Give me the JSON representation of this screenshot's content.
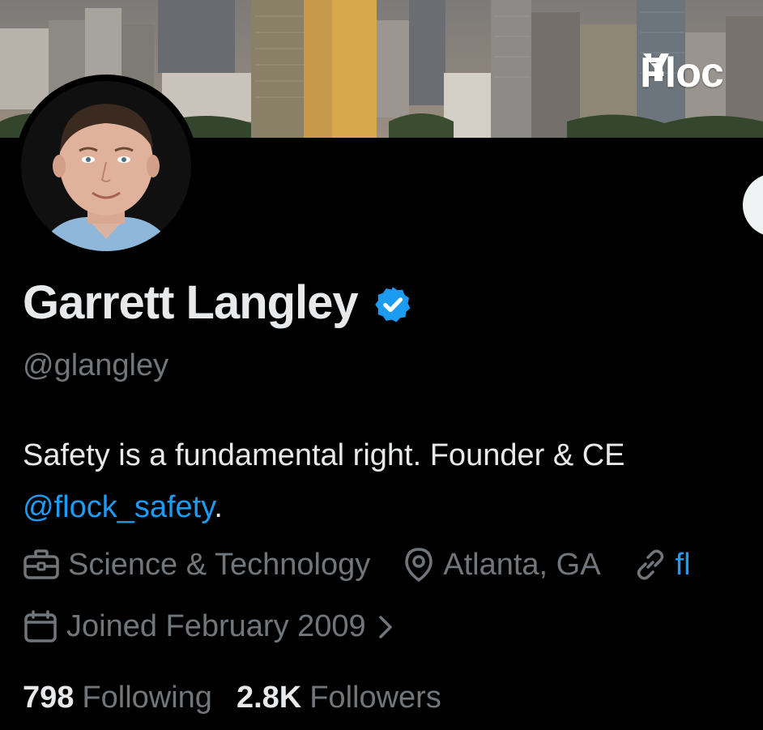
{
  "profile": {
    "display_name": "Garrett Langley",
    "handle": "@glangley",
    "verified": true,
    "bio_text": "Safety is a fundamental right. Founder & CE",
    "bio_mention": "@flock_safety",
    "bio_end": ".",
    "banner_brand": "Floc"
  },
  "meta": {
    "category": "Science & Technology",
    "location": "Atlanta, GA",
    "website": "fl",
    "joined": "Joined February 2009"
  },
  "stats": {
    "following_count": "798",
    "following_label": "Following",
    "followers_count": "2.8K",
    "followers_label": "Followers"
  },
  "icons": {
    "verified": "verified-badge-icon",
    "category": "briefcase-icon",
    "location": "location-pin-icon",
    "website": "link-icon",
    "joined": "calendar-icon",
    "chevron": "chevron-right-icon"
  },
  "colors": {
    "background": "#000000",
    "text_primary": "#e7e9ea",
    "text_secondary": "#71767b",
    "accent": "#1d9bf0"
  }
}
